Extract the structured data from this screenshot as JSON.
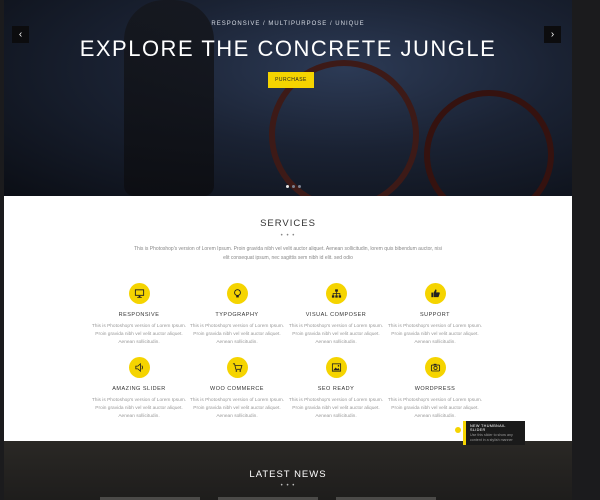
{
  "hero": {
    "tagline": "Responsive / Multipurpose / Unique",
    "headline": "EXPLORE THE CONCRETE JUNGLE",
    "purchase_label": "Purchase",
    "prev_arrow": "‹",
    "next_arrow": "›",
    "slides_total": 3,
    "active_slide": 1
  },
  "services": {
    "title": "SERVICES",
    "dots": "• • •",
    "intro": "This is Photoshop's version of Lorem Ipsum. Proin gravida nibh vel velit auctor aliquet. Aenean sollicitudin, lorem quis bibendum auctor, nisi elit consequat ipsum, nec sagittis sem nibh id elit. sed odio",
    "items": [
      {
        "title": "Responsive",
        "icon": "monitor-icon",
        "desc": "This is Photoshop's version of Lorem Ipsum. Proin gravida nibh vel velit auctor aliquet. Aenean sollicitudin."
      },
      {
        "title": "Typography",
        "icon": "lightbulb-icon",
        "desc": "This is Photoshop's version of Lorem Ipsum. Proin gravida nibh vel velit auctor aliquet. Aenean sollicitudin."
      },
      {
        "title": "Visual Composer",
        "icon": "sitemap-icon",
        "desc": "This is Photoshop's version of Lorem Ipsum. Proin gravida nibh vel velit auctor aliquet. Aenean sollicitudin."
      },
      {
        "title": "Support",
        "icon": "thumbs-up-icon",
        "desc": "This is Photoshop's version of Lorem Ipsum. Proin gravida nibh vel velit auctor aliquet. Aenean sollicitudin."
      },
      {
        "title": "Amazing Slider",
        "icon": "speaker-icon",
        "desc": "This is Photoshop's version of Lorem Ipsum. Proin gravida nibh vel velit auctor aliquet. Aenean sollicitudin."
      },
      {
        "title": "Woo Commerce",
        "icon": "cart-icon",
        "desc": "This is Photoshop's version of Lorem Ipsum. Proin gravida nibh vel velit auctor aliquet. Aenean sollicitudin."
      },
      {
        "title": "SEO Ready",
        "icon": "image-icon",
        "desc": "This is Photoshop's version of Lorem Ipsum. Proin gravida nibh vel velit auctor aliquet. Aenean sollicitudin."
      },
      {
        "title": "Wordpress",
        "icon": "camera-icon",
        "desc": "This is Photoshop's version of Lorem Ipsum. Proin gravida nibh vel velit auctor aliquet. Aenean sollicitudin."
      }
    ]
  },
  "news": {
    "title": "LATEST NEWS",
    "dots": "• • •"
  },
  "popup": {
    "title": "New Thumbnail Slider",
    "text": "Use this slider to show any content in a stylish manner"
  },
  "colors": {
    "accent": "#f5d400",
    "page_bg": "#1b1b1d"
  }
}
